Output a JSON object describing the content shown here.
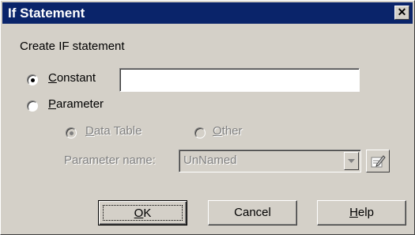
{
  "dialog": {
    "title": "If Statement",
    "close_symbol": "✕",
    "create_label": "Create IF statement",
    "constant": {
      "label_first": "C",
      "label_rest": "onstant",
      "selected": true,
      "value": ""
    },
    "parameter": {
      "label_first": "P",
      "label_rest": "arameter",
      "selected": false
    },
    "data_table": {
      "label_first": "D",
      "label_rest": "ata Table",
      "selected": true,
      "enabled": false
    },
    "other": {
      "label_first": "O",
      "label_rest": "ther",
      "selected": false,
      "enabled": false
    },
    "parameter_name": {
      "label": "Parameter name:",
      "value": "UnNamed"
    },
    "buttons": {
      "ok_first": "O",
      "ok_rest": "K",
      "cancel": "Cancel",
      "help_first": "H",
      "help_rest": "elp"
    }
  }
}
